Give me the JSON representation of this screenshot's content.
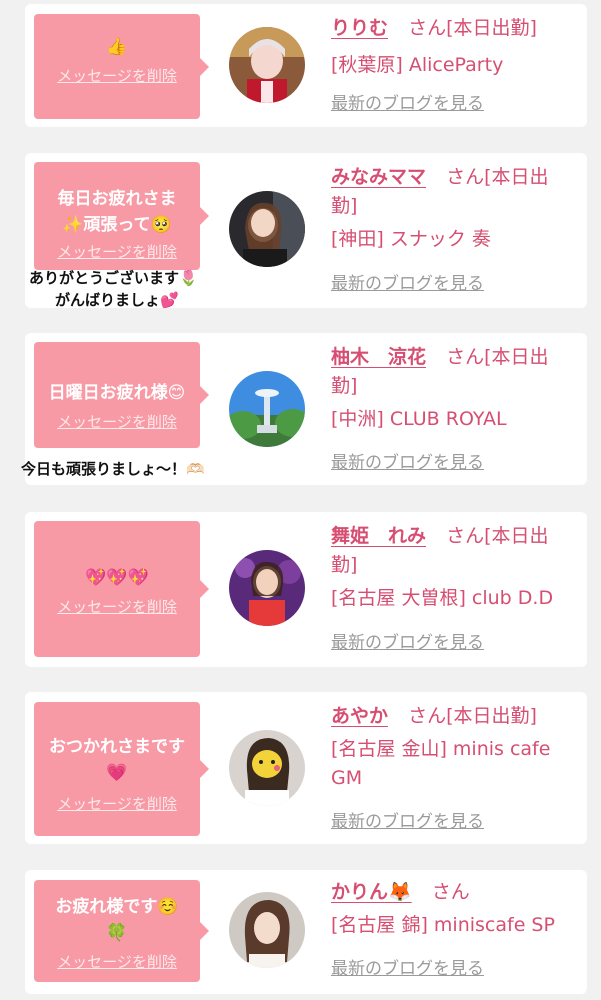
{
  "common": {
    "delete_label": "メッセージを削除",
    "blog_label": "最新のブログを見る",
    "honorific": "さん"
  },
  "cards": [
    {
      "message": "👍",
      "name": "りりむ",
      "status": "[本日出勤]",
      "shop": "[秋葉原] AliceParty"
    },
    {
      "message": "毎日お疲れさま✨頑張って🥺",
      "name": "みなみママ",
      "status": "[本日出勤]",
      "shop": "[神田] スナック 奏",
      "reply": [
        "ありがとうございます🌷",
        "がんばりましょ💕"
      ]
    },
    {
      "message": "日曜日お疲れ様😊",
      "name": "柚木　涼花",
      "status": "[本日出勤]",
      "shop": "[中洲] CLUB ROYAL",
      "reply": [
        "今日も頑張りましょ〜！🫶🏻"
      ]
    },
    {
      "message": "💖💖💖",
      "name": "舞姫　れみ",
      "status": "[本日出勤]",
      "shop": "[名古屋 大曽根] club D.D"
    },
    {
      "message": "おつかれさまです💗",
      "name": "あやか",
      "status": "[本日出勤]",
      "shop": "[名古屋 金山] minis cafe GM"
    },
    {
      "message": "お疲れ様です☺️🍀",
      "name": "かりん🦊",
      "status": "",
      "shop": "[名古屋 錦] miniscafe SP"
    }
  ]
}
